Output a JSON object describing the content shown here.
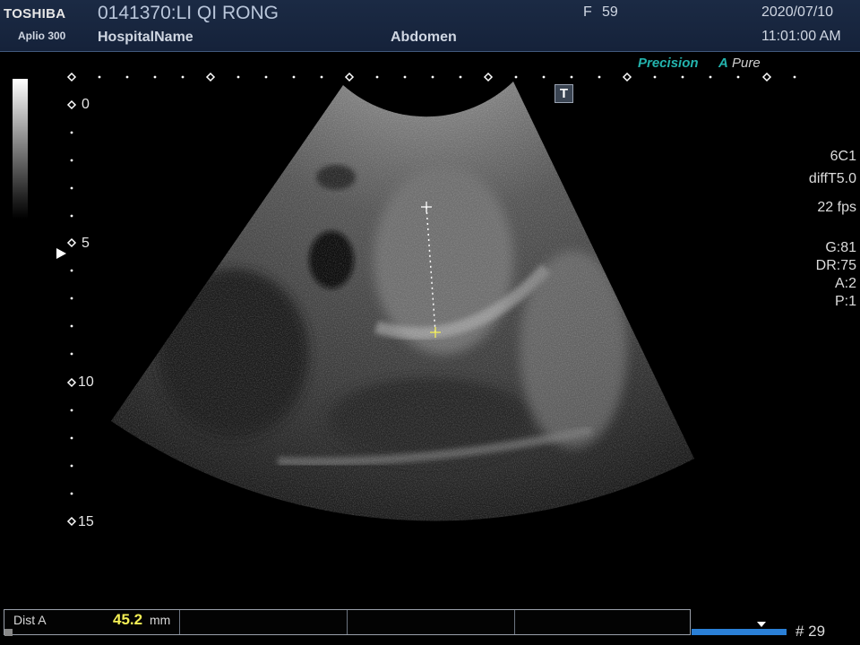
{
  "header": {
    "brand": "TOSHIBA",
    "model": "Aplio 300",
    "patient": "0141370:LI QI RONG",
    "hospital": "HospitalName",
    "exam": "Abdomen",
    "sex": "F",
    "age": "59",
    "date": "2020/07/10",
    "time": "11:01:00 AM"
  },
  "modes": {
    "precision": "Precision",
    "apure_a": "A",
    "apure_rest": "Pure"
  },
  "t_marker": "T",
  "depth_scale": {
    "labels": [
      "0",
      "5",
      "10",
      "15"
    ]
  },
  "params": {
    "probe": "6C1",
    "mode": "diffT5.0",
    "fps": "22 fps",
    "gain": "G:81",
    "dr": "DR:75",
    "a": "A:2",
    "p": "P:1"
  },
  "measurement": {
    "label": "Dist A",
    "value": "45.2",
    "unit": "mm"
  },
  "cine": {
    "frame": "# 29"
  },
  "colors": {
    "header_bg": "#17243d",
    "accent_teal": "#23b3ad",
    "measure_yellow": "#f4ef55",
    "cine_blue": "#2a7fd6"
  }
}
